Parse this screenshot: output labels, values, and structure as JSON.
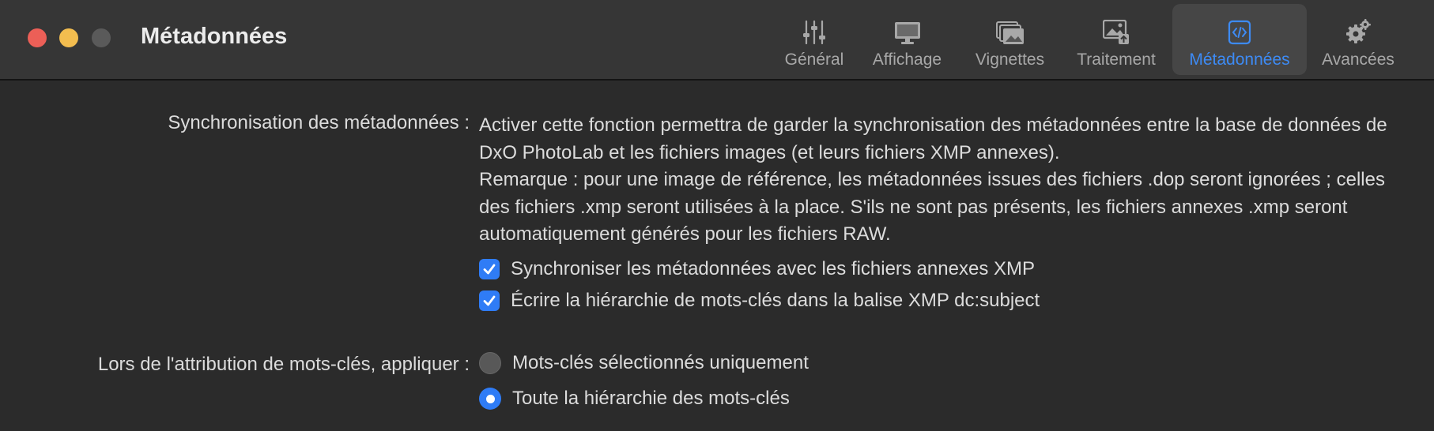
{
  "window": {
    "title": "Métadonnées"
  },
  "toolbar": {
    "tabs": [
      {
        "label": "Général",
        "icon": "sliders-icon"
      },
      {
        "label": "Affichage",
        "icon": "monitor-icon"
      },
      {
        "label": "Vignettes",
        "icon": "thumbnails-icon"
      },
      {
        "label": "Traitement",
        "icon": "export-image-icon"
      },
      {
        "label": "Métadonnées",
        "icon": "metadata-code-icon",
        "selected": true
      },
      {
        "label": "Avancées",
        "icon": "gears-icon"
      }
    ]
  },
  "sync": {
    "label": "Synchronisation des métadonnées :",
    "description_1": "Activer cette fonction permettra de garder la synchronisation des métadonnées entre la base de données de DxO PhotoLab et les fichiers images (et leurs fichiers XMP annexes).",
    "description_2": "Remarque : pour une image de référence, les métadonnées issues des fichiers .dop seront ignorées ; celles des fichiers .xmp seront utilisées à la place. S'ils ne sont pas présents, les fichiers annexes .xmp seront automatiquement générés pour les fichiers RAW.",
    "checkbox_sync_xmp": {
      "label": "Synchroniser les métadonnées avec les fichiers annexes XMP",
      "checked": true
    },
    "checkbox_hierarchy": {
      "label": "Écrire la hiérarchie de mots-clés dans la balise XMP dc:subject",
      "checked": true
    }
  },
  "keywords": {
    "label": "Lors de l'attribution de mots-clés, appliquer :",
    "options": [
      {
        "label": "Mots-clés sélectionnés uniquement",
        "selected": false
      },
      {
        "label": "Toute la hiérarchie des mots-clés",
        "selected": true
      }
    ]
  },
  "colors": {
    "accent": "#2f7cf6",
    "selected_tab_text": "#3d8bf5",
    "close": "#ec5f57",
    "minimize": "#f3bd4f"
  }
}
